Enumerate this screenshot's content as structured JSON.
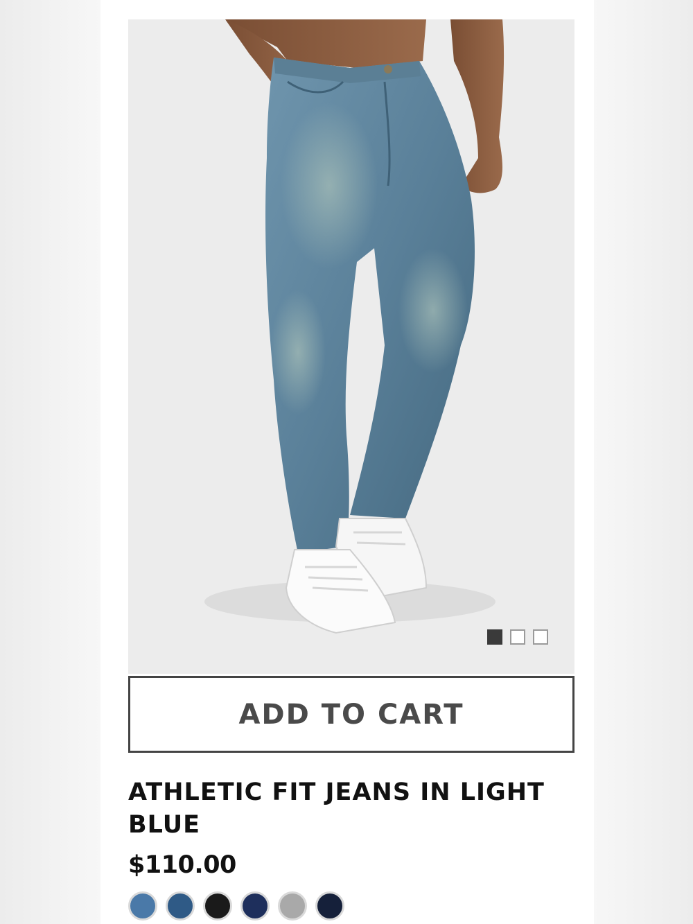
{
  "product": {
    "title": "ATHLETIC FIT JEANS IN LIGHT BLUE",
    "price": "$110.00",
    "add_to_cart_label": "ADD TO CART"
  },
  "carousel": {
    "image_count": 3,
    "active_index": 0
  },
  "swatches": [
    {
      "name": "light-blue",
      "color": "#4a79a8"
    },
    {
      "name": "mid-blue",
      "color": "#2f5a86"
    },
    {
      "name": "black",
      "color": "#1a1a1a"
    },
    {
      "name": "dark-indigo",
      "color": "#1e2f5c"
    },
    {
      "name": "grey",
      "color": "#a9a9a9"
    },
    {
      "name": "navy",
      "color": "#15203a"
    }
  ],
  "colors": {
    "accent": "#444444",
    "image_background": "#ececec"
  }
}
